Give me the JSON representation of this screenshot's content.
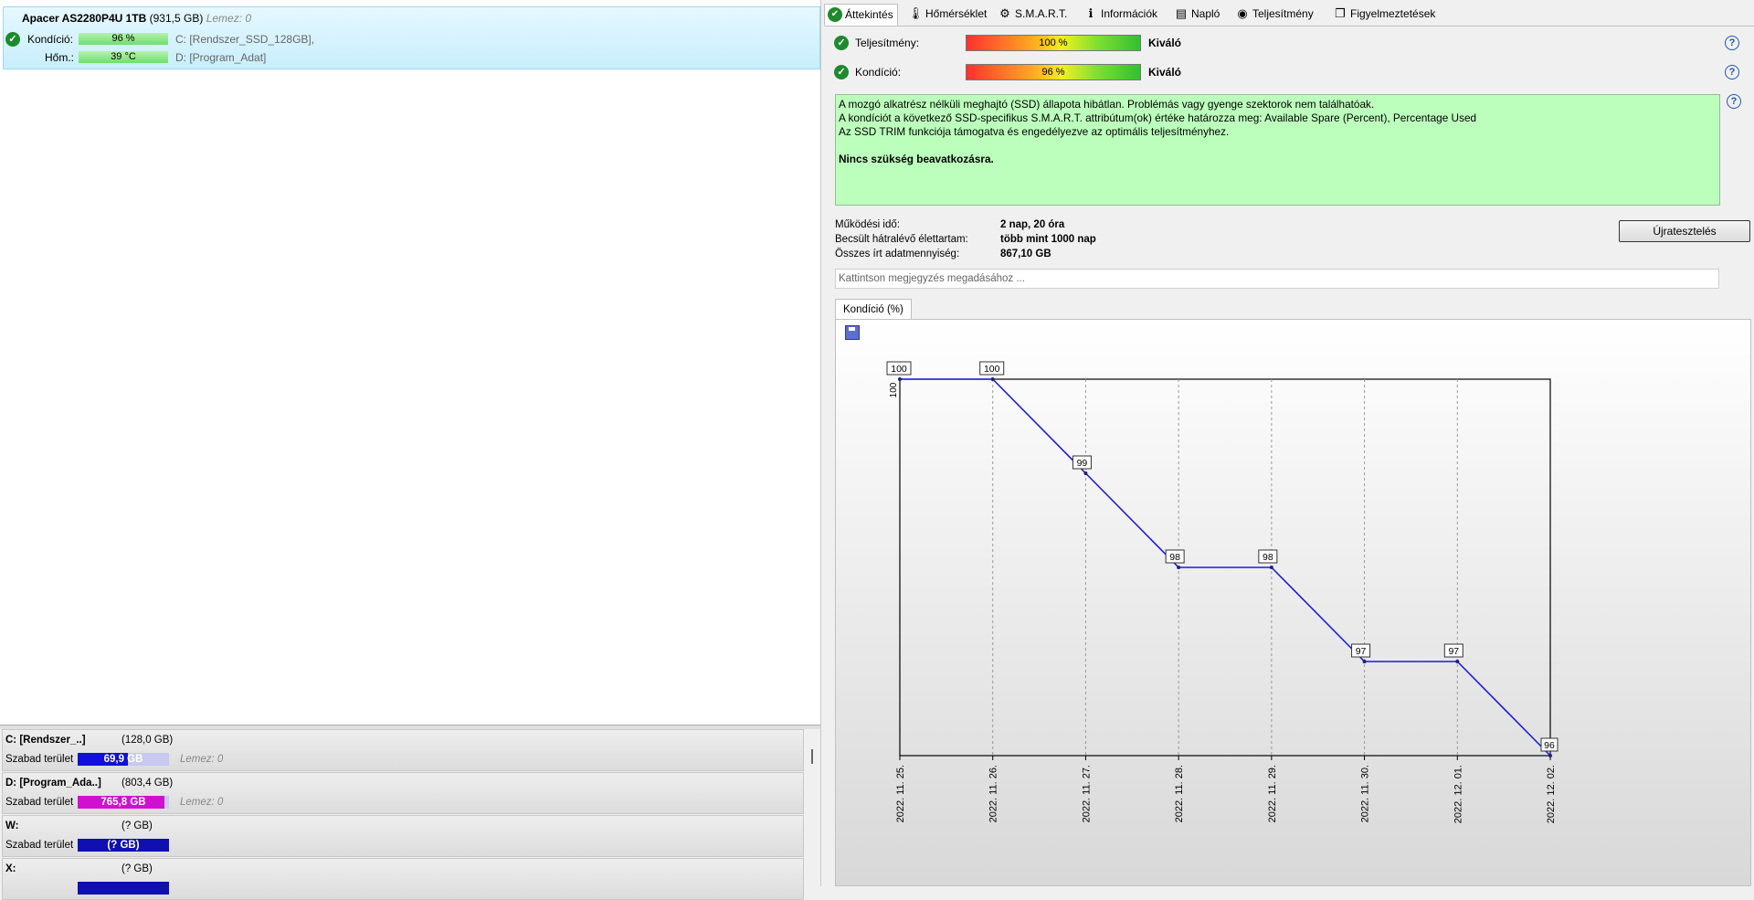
{
  "disk": {
    "name": "Apacer AS2280P4U 1TB",
    "size": "(931,5 GB)",
    "lemez": "Lemez: 0",
    "health_label": "Kondíció:",
    "health_value": "96 %",
    "temp_label": "Hőm.:",
    "temp_value": "39 °C",
    "part_c": "C: [Rendszer_SSD_128GB],",
    "part_d": "D: [Program_Adat]"
  },
  "volumes": [
    {
      "name": "C: [Rendszer_..]",
      "size": "(128,0 GB)",
      "free_label": "Szabad terület",
      "free": "69,9 GB",
      "lemez": "Lemez: 0",
      "bar_color": "#1010d8",
      "fill": 0.55
    },
    {
      "name": "D: [Program_Ada..]",
      "size": "(803,4 GB)",
      "free_label": "Szabad terület",
      "free": "765,8 GB",
      "lemez": "Lemez: 0",
      "bar_color": "#d010d0",
      "fill": 0.95
    },
    {
      "name": "W:",
      "size": "(? GB)",
      "free_label": "Szabad terület",
      "free": "(? GB)",
      "lemez": "",
      "bar_color": "#1010b0",
      "fill": 1
    },
    {
      "name": "X:",
      "size": "(? GB)",
      "free_label": "",
      "free": "",
      "lemez": "",
      "bar_color": "#1010b0",
      "fill": 1
    }
  ],
  "tabs": [
    {
      "label": "Áttekintés",
      "icon": "check-circle-icon",
      "glyph": "✔"
    },
    {
      "label": "Hőmérséklet",
      "icon": "thermometer-icon",
      "glyph": "🌡"
    },
    {
      "label": "S.M.A.R.T.",
      "icon": "smart-icon",
      "glyph": "⚙"
    },
    {
      "label": "Információk",
      "icon": "info-icon",
      "glyph": "ℹ"
    },
    {
      "label": "Napló",
      "icon": "log-icon",
      "glyph": "▤"
    },
    {
      "label": "Teljesítmény",
      "icon": "performance-icon",
      "glyph": "◉"
    },
    {
      "label": "Figyelmeztetések",
      "icon": "warnings-icon",
      "glyph": "❐"
    }
  ],
  "overview": {
    "perf_label": "Teljesítmény:",
    "perf_value": "100 %",
    "perf_rating": "Kiváló",
    "health_label": "Kondíció:",
    "health_value": "96 %",
    "health_rating": "Kiváló",
    "msg1": "A mozgó alkatrész nélküli meghajtó (SSD) állapota hibátlan. Problémás vagy gyenge szektorok nem találhatóak.",
    "msg2": "A kondíciót a következő SSD-specifikus S.M.A.R.T. attribútum(ok) értéke határozza meg:  Available Spare (Percent), Percentage Used",
    "msg3": "Az SSD TRIM funkciója támogatva és engedélyezve az optimális teljesítményhez.",
    "msg4": "Nincs szükség beavatkozásra.",
    "uptime_label": "Működési idő:",
    "uptime_value": "2 nap, 20 óra",
    "life_label": "Becsült hátralévő élettartam:",
    "life_value": "több mint 1000 nap",
    "written_label": "Összes írt adatmennyiség:",
    "written_value": "867,10 GB",
    "retest_label": "Újratesztelés",
    "note_placeholder": "Kattintson megjegyzés megadásához ...",
    "chart_tab": "Kondíció  (%)"
  },
  "chart_data": {
    "type": "line",
    "x": [
      "2022. 11. 25.",
      "2022. 11. 26.",
      "2022. 11. 27.",
      "2022. 11. 28.",
      "2022. 11. 29.",
      "2022. 11. 30.",
      "2022. 12. 01.",
      "2022. 12. 02."
    ],
    "values": [
      100,
      100,
      99,
      98,
      98,
      97,
      97,
      96
    ],
    "ylim": [
      96,
      100
    ],
    "y_tick_label": "100",
    "grid": true,
    "line_color": "#1a1ae0"
  }
}
